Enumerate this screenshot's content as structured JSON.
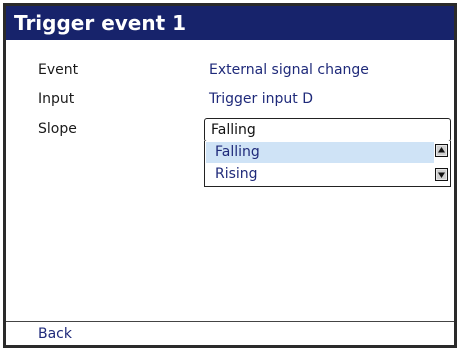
{
  "window": {
    "title": "Trigger event 1"
  },
  "fields": [
    {
      "label": "Event",
      "value": "External signal change"
    },
    {
      "label": "Input",
      "value": "Trigger input D"
    },
    {
      "label": "Slope",
      "value": "Falling"
    }
  ],
  "slope_dropdown": {
    "options": [
      "Falling",
      "Rising"
    ],
    "selected": "Falling"
  },
  "footer": {
    "back_label": "Back"
  },
  "colors": {
    "title_bar": "#17236b",
    "value_text": "#1f2a7a",
    "selected_option": "#cfe3f6"
  }
}
